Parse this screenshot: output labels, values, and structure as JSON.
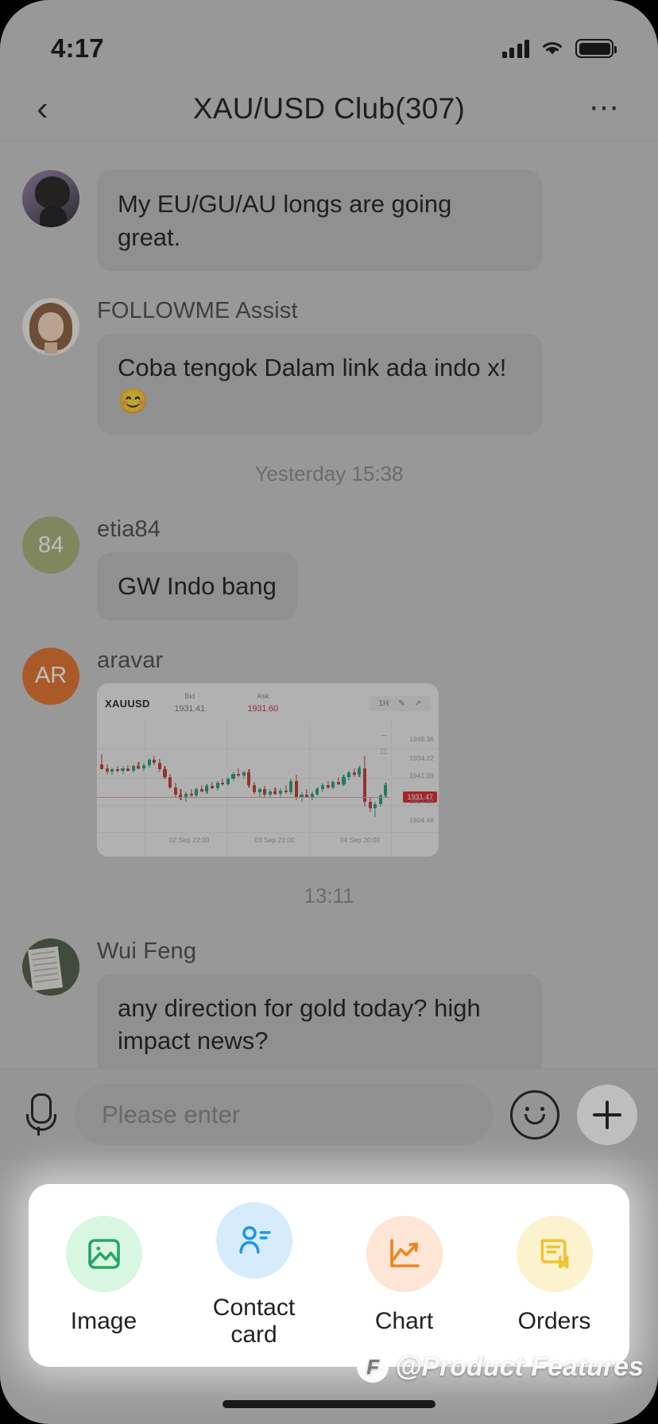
{
  "status_bar": {
    "time": "4:17",
    "signal_icon": "signal-bars-icon",
    "wifi_icon": "wifi-icon",
    "battery_icon": "battery-icon"
  },
  "nav": {
    "back_icon": "chevron-left-icon",
    "title": "XAU/USD Club(307)",
    "more_icon": "ellipsis-icon"
  },
  "messages": [
    {
      "sender": "",
      "avatar_initials": "",
      "text": "My EU/GU/AU longs are going great.",
      "type": "text"
    },
    {
      "sender": "FOLLOWME Assist",
      "avatar_initials": "",
      "text": "Coba tengok Dalam link ada indo x! 😊",
      "type": "text"
    },
    {
      "sender": "etia84",
      "avatar_initials": "84",
      "text": "GW Indo bang",
      "type": "text"
    },
    {
      "sender": "aravar",
      "avatar_initials": "AR",
      "text": "",
      "type": "chart"
    },
    {
      "sender": "Wui Feng",
      "avatar_initials": "",
      "text": "any direction for gold today? high impact news?",
      "type": "text"
    }
  ],
  "timestamps": {
    "day_divider": "Yesterday 15:38",
    "chart_time": "13:11"
  },
  "chart_data": {
    "type": "candlestick",
    "symbol": "XAUUSD",
    "bid_label": "Bid",
    "bid_value": "1931.41",
    "ask_label": "Ask",
    "ask_value": "1931.60",
    "timeframe": "1H",
    "tools": [
      "1H",
      "draw-tool-icon",
      "indicator-icon"
    ],
    "current_price_tag": "1931.47",
    "y_ticks": [
      "1946.36",
      "1934.22",
      "1941.09",
      "1917.22",
      "1904.48"
    ],
    "x_ticks": [
      "02 Sep 22:00",
      "03 Sep 21:00",
      "04 Sep 20:00"
    ],
    "ohlc": [
      {
        "o": 62,
        "h": 72,
        "l": 58,
        "c": 57,
        "dir": "down"
      },
      {
        "o": 58,
        "h": 62,
        "l": 52,
        "c": 55,
        "dir": "down"
      },
      {
        "o": 55,
        "h": 59,
        "l": 52,
        "c": 57,
        "dir": "up"
      },
      {
        "o": 57,
        "h": 60,
        "l": 54,
        "c": 56,
        "dir": "down"
      },
      {
        "o": 56,
        "h": 60,
        "l": 53,
        "c": 58,
        "dir": "up"
      },
      {
        "o": 58,
        "h": 61,
        "l": 55,
        "c": 56,
        "dir": "down"
      },
      {
        "o": 56,
        "h": 62,
        "l": 54,
        "c": 60,
        "dir": "up"
      },
      {
        "o": 60,
        "h": 64,
        "l": 57,
        "c": 58,
        "dir": "down"
      },
      {
        "o": 58,
        "h": 63,
        "l": 56,
        "c": 61,
        "dir": "up"
      },
      {
        "o": 61,
        "h": 68,
        "l": 59,
        "c": 66,
        "dir": "up"
      },
      {
        "o": 66,
        "h": 70,
        "l": 61,
        "c": 63,
        "dir": "down"
      },
      {
        "o": 63,
        "h": 67,
        "l": 55,
        "c": 57,
        "dir": "down"
      },
      {
        "o": 57,
        "h": 60,
        "l": 48,
        "c": 50,
        "dir": "down"
      },
      {
        "o": 50,
        "h": 53,
        "l": 38,
        "c": 40,
        "dir": "down"
      },
      {
        "o": 40,
        "h": 44,
        "l": 30,
        "c": 33,
        "dir": "down"
      },
      {
        "o": 33,
        "h": 38,
        "l": 28,
        "c": 30,
        "dir": "down"
      },
      {
        "o": 30,
        "h": 36,
        "l": 26,
        "c": 34,
        "dir": "up"
      },
      {
        "o": 34,
        "h": 38,
        "l": 30,
        "c": 32,
        "dir": "down"
      },
      {
        "o": 32,
        "h": 40,
        "l": 31,
        "c": 38,
        "dir": "up"
      },
      {
        "o": 38,
        "h": 42,
        "l": 35,
        "c": 36,
        "dir": "down"
      },
      {
        "o": 36,
        "h": 43,
        "l": 34,
        "c": 41,
        "dir": "up"
      },
      {
        "o": 41,
        "h": 45,
        "l": 38,
        "c": 39,
        "dir": "down"
      },
      {
        "o": 39,
        "h": 46,
        "l": 37,
        "c": 44,
        "dir": "up"
      },
      {
        "o": 44,
        "h": 48,
        "l": 41,
        "c": 43,
        "dir": "down"
      },
      {
        "o": 43,
        "h": 50,
        "l": 41,
        "c": 48,
        "dir": "up"
      },
      {
        "o": 48,
        "h": 55,
        "l": 46,
        "c": 53,
        "dir": "up"
      },
      {
        "o": 53,
        "h": 58,
        "l": 50,
        "c": 51,
        "dir": "down"
      },
      {
        "o": 51,
        "h": 56,
        "l": 48,
        "c": 54,
        "dir": "up"
      },
      {
        "o": 54,
        "h": 57,
        "l": 40,
        "c": 42,
        "dir": "down"
      },
      {
        "o": 42,
        "h": 45,
        "l": 33,
        "c": 35,
        "dir": "down"
      },
      {
        "o": 35,
        "h": 40,
        "l": 30,
        "c": 38,
        "dir": "up"
      },
      {
        "o": 38,
        "h": 41,
        "l": 31,
        "c": 33,
        "dir": "down"
      },
      {
        "o": 33,
        "h": 38,
        "l": 30,
        "c": 36,
        "dir": "up"
      },
      {
        "o": 36,
        "h": 40,
        "l": 33,
        "c": 34,
        "dir": "down"
      },
      {
        "o": 34,
        "h": 39,
        "l": 31,
        "c": 37,
        "dir": "up"
      },
      {
        "o": 37,
        "h": 42,
        "l": 34,
        "c": 35,
        "dir": "down"
      },
      {
        "o": 35,
        "h": 48,
        "l": 33,
        "c": 46,
        "dir": "up"
      },
      {
        "o": 46,
        "h": 52,
        "l": 28,
        "c": 30,
        "dir": "down"
      },
      {
        "o": 30,
        "h": 35,
        "l": 26,
        "c": 33,
        "dir": "up"
      },
      {
        "o": 33,
        "h": 38,
        "l": 30,
        "c": 31,
        "dir": "down"
      },
      {
        "o": 31,
        "h": 36,
        "l": 28,
        "c": 34,
        "dir": "up"
      },
      {
        "o": 34,
        "h": 40,
        "l": 32,
        "c": 38,
        "dir": "up"
      },
      {
        "o": 38,
        "h": 44,
        "l": 35,
        "c": 42,
        "dir": "up"
      },
      {
        "o": 42,
        "h": 46,
        "l": 38,
        "c": 40,
        "dir": "down"
      },
      {
        "o": 40,
        "h": 47,
        "l": 38,
        "c": 45,
        "dir": "up"
      },
      {
        "o": 45,
        "h": 50,
        "l": 42,
        "c": 43,
        "dir": "down"
      },
      {
        "o": 43,
        "h": 52,
        "l": 41,
        "c": 50,
        "dir": "up"
      },
      {
        "o": 50,
        "h": 56,
        "l": 47,
        "c": 54,
        "dir": "up"
      },
      {
        "o": 54,
        "h": 58,
        "l": 50,
        "c": 52,
        "dir": "down"
      },
      {
        "o": 52,
        "h": 60,
        "l": 50,
        "c": 58,
        "dir": "up"
      },
      {
        "o": 58,
        "h": 70,
        "l": 22,
        "c": 26,
        "dir": "down"
      },
      {
        "o": 26,
        "h": 30,
        "l": 16,
        "c": 20,
        "dir": "down"
      },
      {
        "o": 20,
        "h": 26,
        "l": 12,
        "c": 24,
        "dir": "up"
      },
      {
        "o": 24,
        "h": 34,
        "l": 22,
        "c": 32,
        "dir": "up"
      },
      {
        "o": 32,
        "h": 44,
        "l": 30,
        "c": 42,
        "dir": "up"
      }
    ]
  },
  "input_bar": {
    "mic_icon": "microphone-icon",
    "placeholder": "Please enter",
    "value": "",
    "emoji_icon": "smiley-face-icon",
    "plus_icon": "plus-icon"
  },
  "attachment_panel": {
    "items": [
      {
        "label": "Image",
        "icon": "image-icon",
        "bg": "#d9f6e0",
        "fg": "#23a765"
      },
      {
        "label": "Contact card",
        "icon": "contact-card-icon",
        "bg": "#d6ecfd",
        "fg": "#1f97e8"
      },
      {
        "label": "Chart",
        "icon": "line-chart-icon",
        "bg": "#fde6d6",
        "fg": "#f08322"
      },
      {
        "label": "Orders",
        "icon": "orders-doc-icon",
        "bg": "#fdf2ce",
        "fg": "#eec433"
      }
    ]
  },
  "watermark": {
    "logo": "F",
    "text": "@Product Features"
  }
}
